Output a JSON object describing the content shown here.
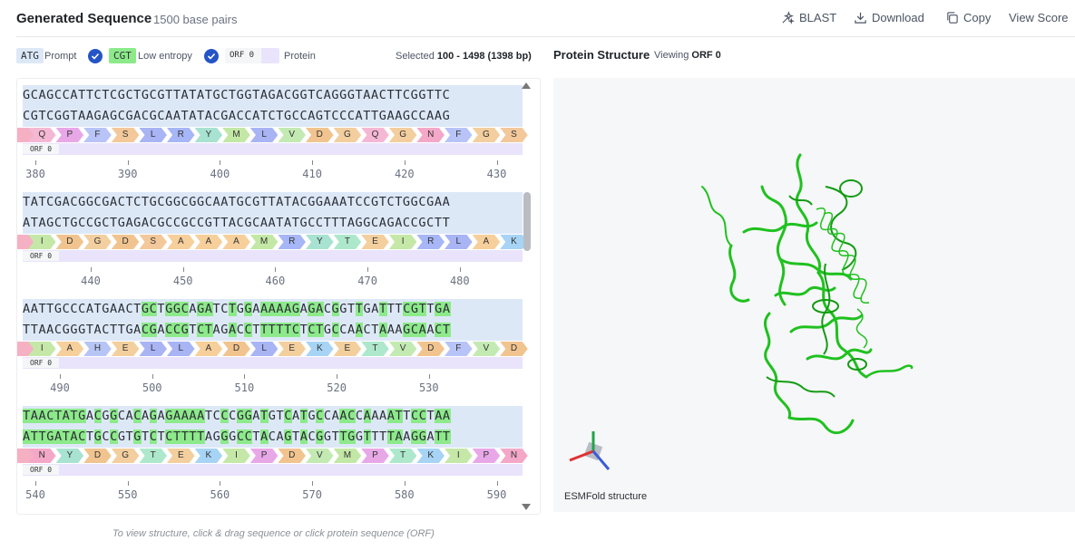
{
  "header": {
    "title": "Generated Sequence",
    "subtitle": "1500 base pairs",
    "actions": [
      {
        "label": "BLAST",
        "icon": "blast-icon"
      },
      {
        "label": "Download",
        "icon": "download-icon"
      },
      {
        "label": "Copy",
        "icon": "copy-icon"
      },
      {
        "label": "View Score",
        "icon": ""
      }
    ]
  },
  "legend": {
    "prompt_swatch": "ATG",
    "prompt_label": "Prompt",
    "entropy_swatch": "CGT",
    "entropy_label": "Low entropy",
    "protein_swatch": "ORF 0",
    "protein_label": "Protein",
    "selected_prefix": "Selected",
    "selected_value": "100 - 1498 (1398 bp)"
  },
  "colors": {
    "accent": "#2554c7",
    "dna_bg": "#dde8f7",
    "low_entropy": "#8dea8a",
    "orf_bg": "#e9e4fb",
    "structure": "#1fc11f"
  },
  "sequence_blocks": [
    {
      "top": "GCAGCCATTCTCGCTGCGTTATATGCTGGTAGACGGTCAGGGTAACTTCGGTTC",
      "bottom": "CGTCGGTAAGAGCGACGCAATATACGACCATCTGCCAGTCCCATTGAAGCCAAG",
      "protein": [
        " ",
        "Q",
        "P",
        "F",
        "S",
        "L",
        "R",
        "Y",
        "M",
        "L",
        "V",
        "D",
        "G",
        "Q",
        "G",
        "N",
        "F",
        "G",
        "S"
      ],
      "orf": "ORF 0",
      "ticks": [
        380,
        390,
        400,
        410,
        420,
        430
      ]
    },
    {
      "top": "TATCGACGGCGACTCTGCGGCGGCAATGCGTTATACGGAAATCCGTCTGGCGAA",
      "bottom": "ATAGCTGCCGCTGAGACGCCGCCGTTACGCAATATGCCTTTAGGCAGACCGCTT",
      "protein": [
        " ",
        "I",
        "D",
        "G",
        "D",
        "S",
        "A",
        "A",
        "A",
        "M",
        "R",
        "Y",
        "T",
        "E",
        "I",
        "R",
        "L",
        "A",
        "K"
      ],
      "orf": "ORF 0",
      "ticks": [
        440,
        450,
        460,
        470,
        480
      ]
    },
    {
      "top": "AATTGCCCATGAACTGCTGGCAGATCTGGAAAAAGAGACGGTTGATTTCGTTGA",
      "bottom": "TTAACGGGTACTTGACGACCGTCTAGACCTTTTTCTCTGCCAACTAAAGCAACT",
      "protein": [
        " ",
        "I",
        "A",
        "H",
        "E",
        "L",
        "L",
        "A",
        "D",
        "L",
        "E",
        "K",
        "E",
        "T",
        "V",
        "D",
        "F",
        "V",
        "D"
      ],
      "orf": "ORF 0",
      "ticks": [
        490,
        500,
        510,
        520,
        530
      ]
    },
    {
      "top": "TAACTATGACGGCACAGAGAAAATCCCGGATGTCATGCCAACCAAAATTCCTAA",
      "bottom": "ATTGATACTGCCGTGTCTCTTTTAGGGCCTACAGTACGGTTGGTTTTAAGGATT",
      "protein": [
        " ",
        "N",
        "Y",
        "D",
        "G",
        "T",
        "E",
        "K",
        "I",
        "P",
        "D",
        "V",
        "M",
        "P",
        "T",
        "K",
        "I",
        "P",
        "N"
      ],
      "orf": "ORF 0",
      "ticks": [
        540,
        550,
        560,
        570,
        580,
        590
      ]
    }
  ],
  "hint": "To view structure, click & drag sequence or click protein sequence (ORF)",
  "structure": {
    "title": "Protein Structure",
    "viewing_prefix": "Viewing",
    "viewing_value": "ORF 0",
    "label": "ESMFold structure"
  }
}
